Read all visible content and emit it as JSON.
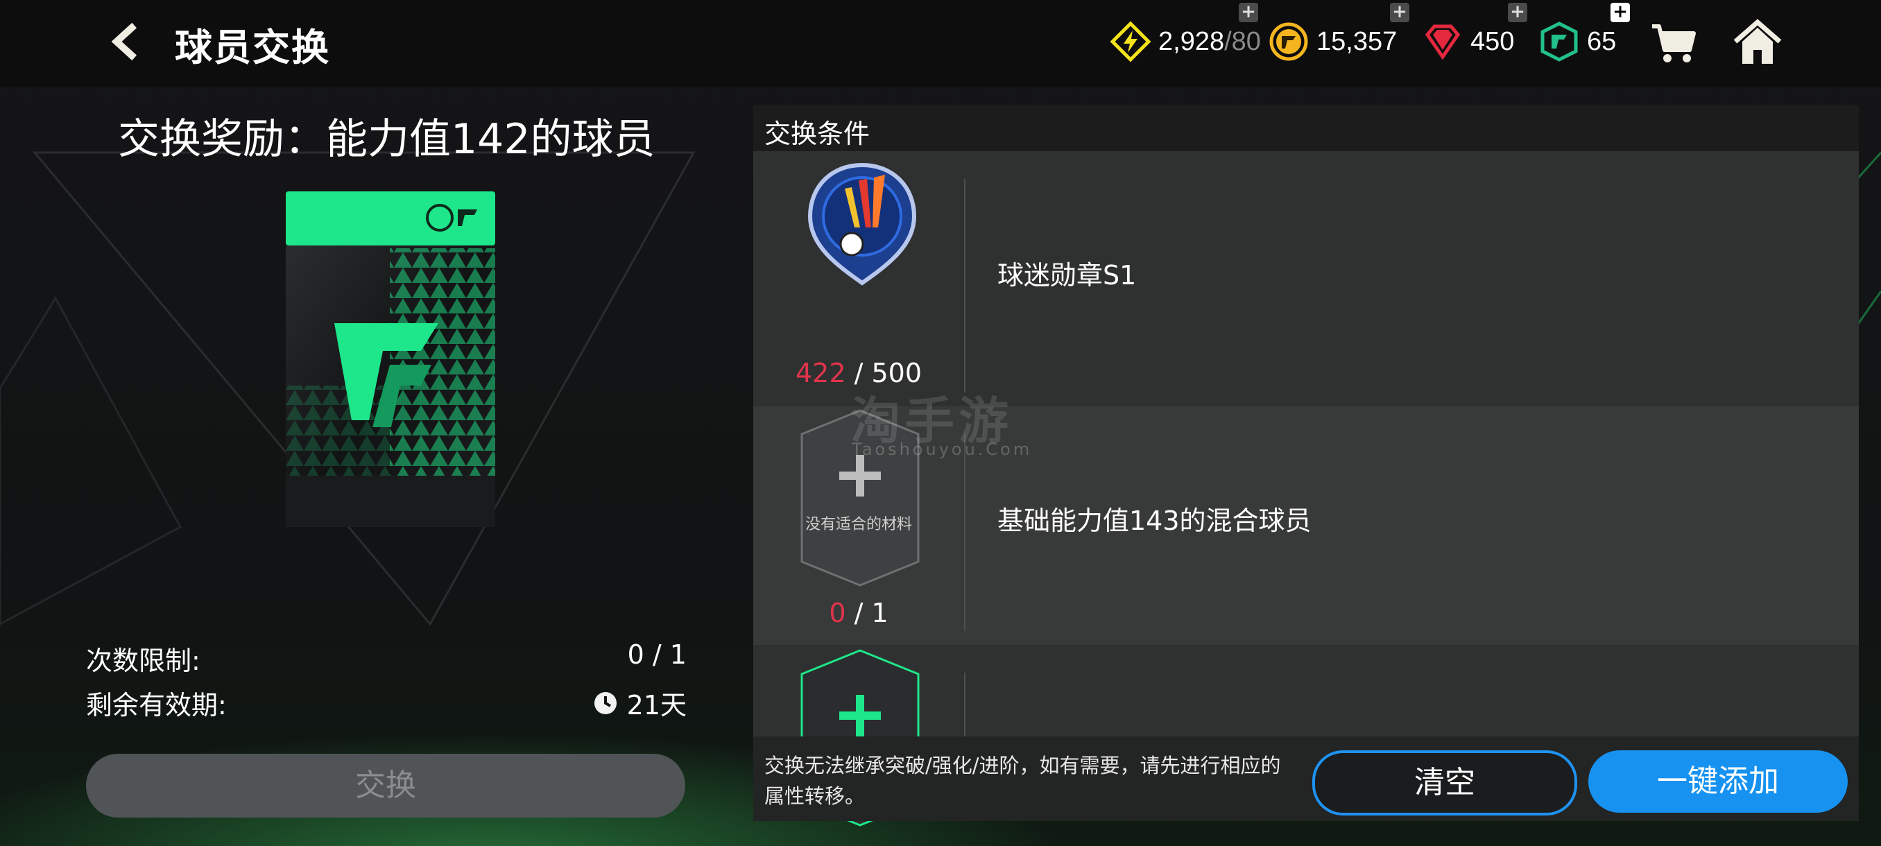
{
  "header": {
    "title": "球员交换",
    "currencies": [
      {
        "icon": "lightning-icon",
        "value": "2,928",
        "max": "/80",
        "color": "#f3e21b"
      },
      {
        "icon": "coin-icon",
        "value": "15,357",
        "color": "#f5b51e"
      },
      {
        "icon": "gem-icon",
        "value": "450",
        "color": "#e4283d"
      },
      {
        "icon": "token-icon",
        "value": "65",
        "color": "#22c08a"
      }
    ],
    "plus_symbol": "+"
  },
  "reward": {
    "title": "交换奖励：能力值142的球员",
    "limit_label": "次数限制:",
    "limit_value": "0 / 1",
    "expiry_label": "剩余有效期:",
    "expiry_value": "21天",
    "exchange_button": "交换"
  },
  "conditions": {
    "header": "交换条件",
    "items": [
      {
        "name": "球迷勋章S1",
        "current": "422",
        "sep": " / ",
        "required": "500"
      },
      {
        "name": "基础能力值143的混合球员",
        "current": "0",
        "sep": " / ",
        "required": "1",
        "empty_label": "没有适合的材料"
      }
    ],
    "note": "交换无法继承突破/强化/进阶，如有需要，请先进行相应的属性转移。",
    "clear_button": "清空",
    "auto_add_button": "一键添加"
  },
  "watermark": {
    "main": "淘手游",
    "sub": "Taoshouyou.Com"
  },
  "colors": {
    "accent_blue": "#1792f0",
    "count_red": "#e0354b",
    "fc_green": "#1ee68a"
  }
}
